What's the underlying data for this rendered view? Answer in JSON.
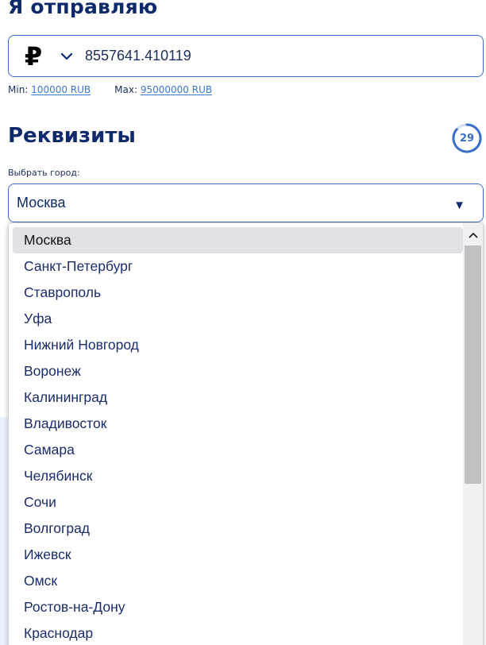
{
  "send_section": {
    "title": "Я отправляю",
    "currency_symbol": "₽",
    "currency_icon": "ruble-icon",
    "amount": "8557641.410119"
  },
  "limits": {
    "min_label": "Min:",
    "min_value": "100000 RUB",
    "max_label": "Max:",
    "max_value": "95000000 RUB"
  },
  "requisites": {
    "title": "Реквизиты",
    "timer_value": "29",
    "city_label": "Выбрать город:",
    "city_selected": "Москва",
    "dropdown_arrow": "▼"
  },
  "city_options": [
    "Москва",
    "Санкт-Петербург",
    "Ставрополь",
    "Уфа",
    "Нижний Новгород",
    "Воронеж",
    "Калининград",
    "Владивосток",
    "Самара",
    "Челябинск",
    "Сочи",
    "Волгоград",
    "Ижевск",
    "Омск",
    "Ростов-на-Дону",
    "Краснодар"
  ],
  "colors": {
    "primary": "#0f2a6b",
    "accent": "#3a6fc6",
    "link": "#3a77c9",
    "selected_bg": "#e2e2e6"
  }
}
